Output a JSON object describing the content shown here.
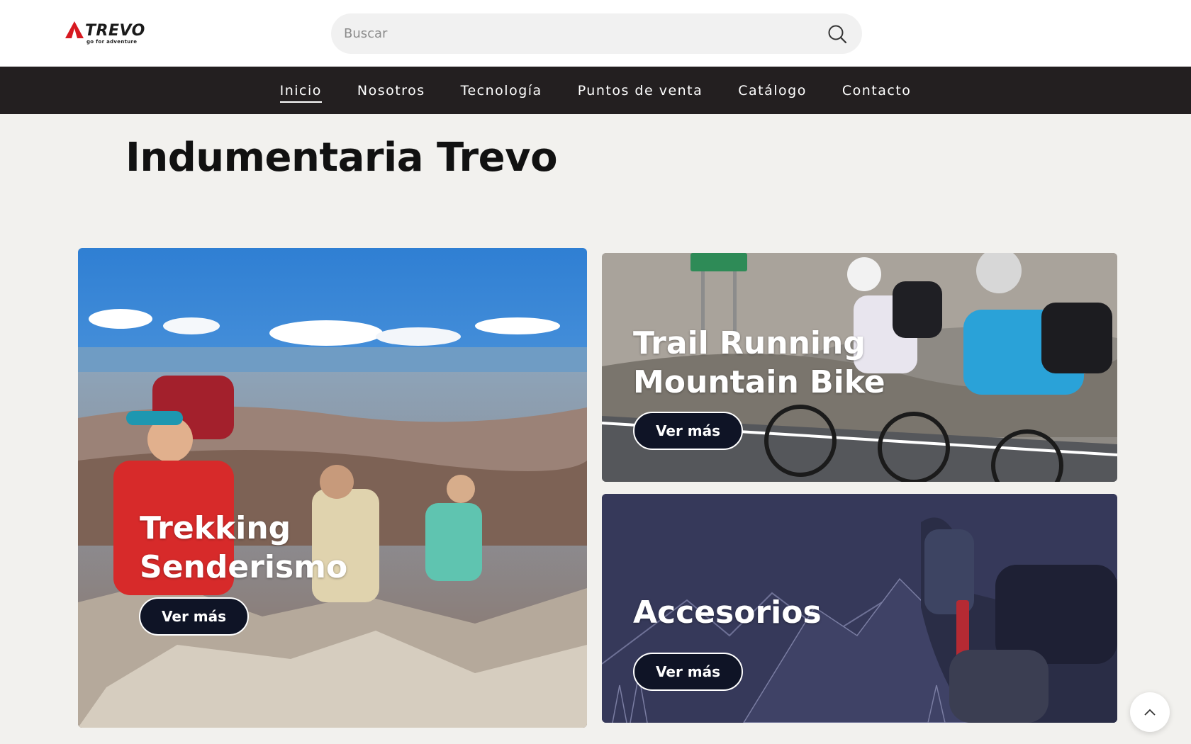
{
  "header": {
    "logo": {
      "name": "TREVO",
      "tagline": "go for adventure"
    },
    "search": {
      "placeholder": "Buscar",
      "icon": "search-icon"
    }
  },
  "nav": {
    "items": [
      {
        "label": "Inicio",
        "active": true
      },
      {
        "label": "Nosotros",
        "active": false
      },
      {
        "label": "Tecnología",
        "active": false
      },
      {
        "label": "Puntos de venta",
        "active": false
      },
      {
        "label": "Catálogo",
        "active": false
      },
      {
        "label": "Contacto",
        "active": false
      }
    ]
  },
  "main": {
    "title": "Indumentaria Trevo",
    "cards": [
      {
        "title_lines": [
          "Trekking",
          "Senderismo"
        ],
        "button": "Ver más"
      },
      {
        "title_lines": [
          "Trail Running",
          "Mountain Bike"
        ],
        "button": "Ver más"
      },
      {
        "title_lines": [
          "Accesorios"
        ],
        "button": "Ver más"
      }
    ]
  },
  "scroll_top": {
    "icon": "chevron-up-icon"
  },
  "colors": {
    "nav_bg": "#231f20",
    "button_bg": "#0f1426",
    "accent_red": "#d71920",
    "accesorios_bg": "#36395a"
  }
}
